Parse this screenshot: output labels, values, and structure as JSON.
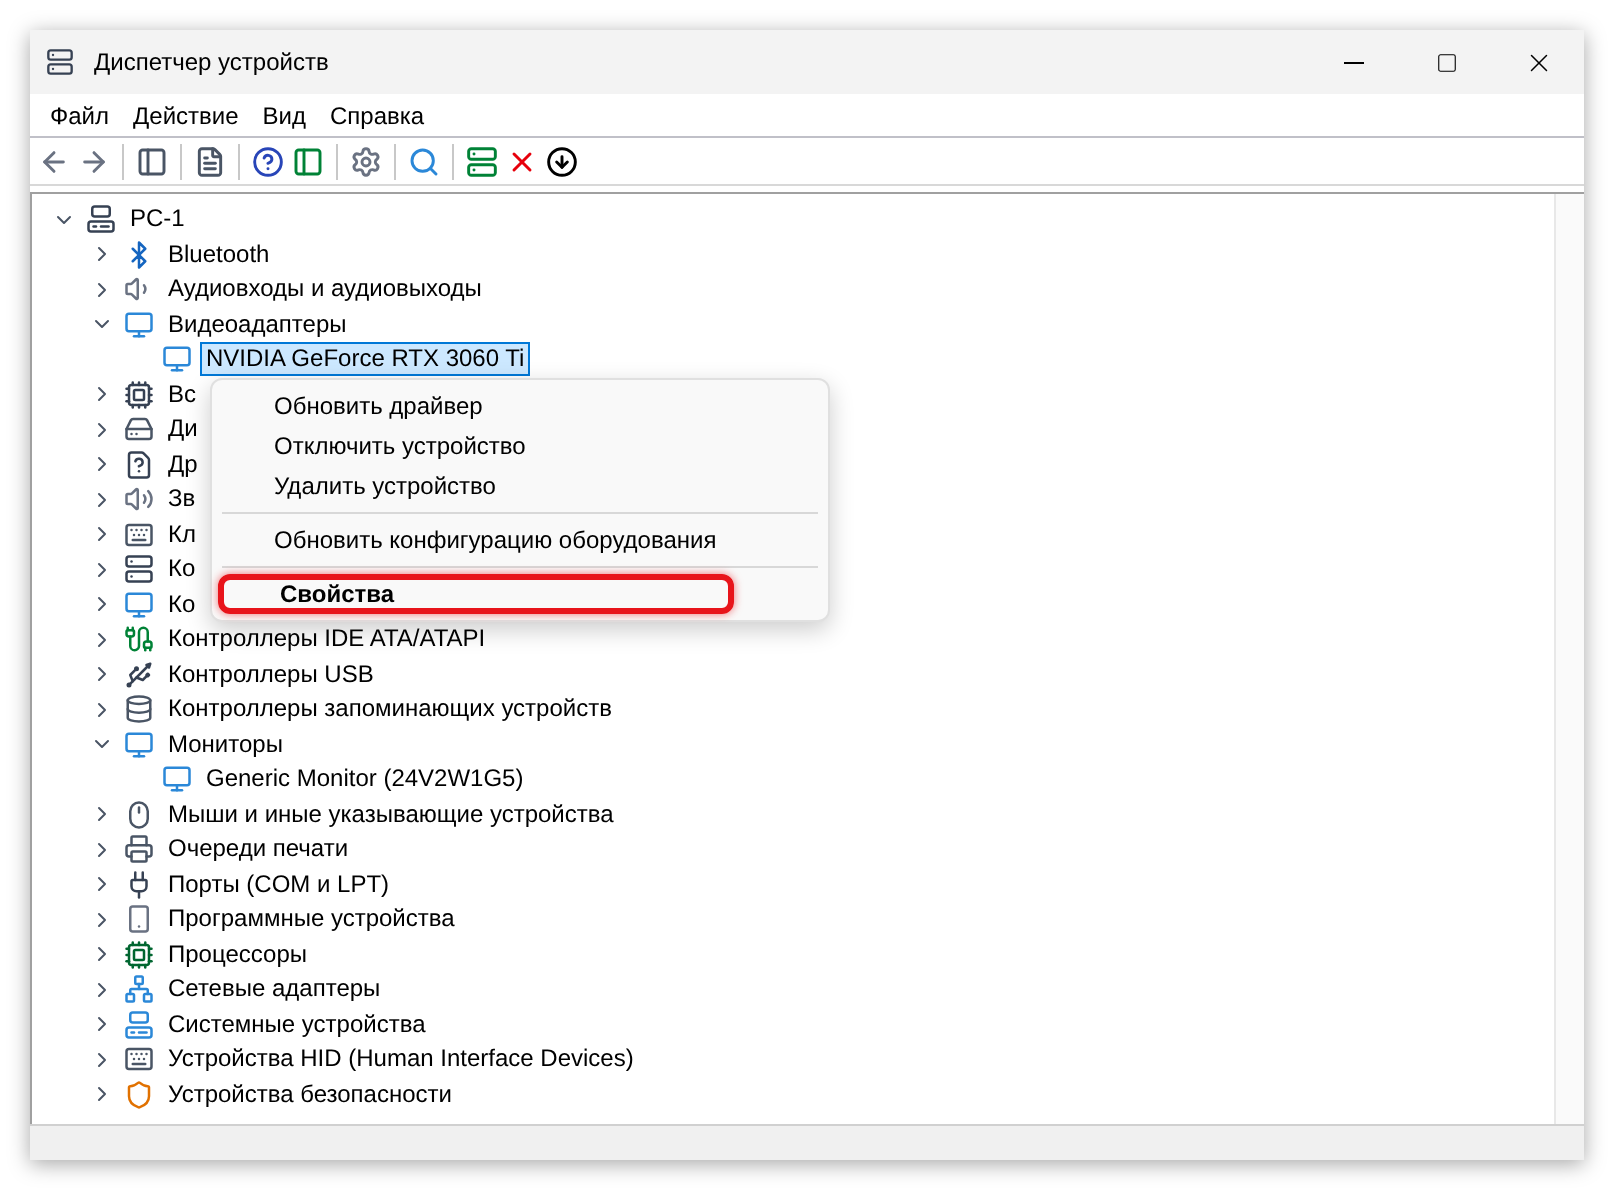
{
  "window": {
    "title": "Диспетчер устройств"
  },
  "menu_bar": [
    "Файл",
    "Действие",
    "Вид",
    "Справка"
  ],
  "tree": {
    "label": "PC-1",
    "expanded": true,
    "selected": false,
    "children": [
      {
        "label": "Bluetooth",
        "expanded": false,
        "selected": false
      },
      {
        "label": "Аудиовходы и аудиовыходы",
        "expanded": false,
        "selected": false
      },
      {
        "label": "Видеоадаптеры",
        "expanded": true,
        "selected": false,
        "children": [
          {
            "label": "NVIDIA GeForce RTX 3060 Ti",
            "selected": true
          }
        ]
      },
      {
        "label": "Вс",
        "expanded": false,
        "selected": false
      },
      {
        "label": "Ди",
        "expanded": false,
        "selected": false
      },
      {
        "label": "Др",
        "expanded": false,
        "selected": false
      },
      {
        "label": "Зв",
        "expanded": false,
        "selected": false
      },
      {
        "label": "Кл",
        "expanded": false,
        "selected": false
      },
      {
        "label": "Ко",
        "expanded": false,
        "selected": false
      },
      {
        "label": "Ко",
        "expanded": false,
        "selected": false
      },
      {
        "label": "Контроллеры IDE ATA/ATAPI",
        "expanded": false,
        "selected": false
      },
      {
        "label": "Контроллеры USB",
        "expanded": false,
        "selected": false
      },
      {
        "label": "Контроллеры запоминающих устройств",
        "expanded": false,
        "selected": false
      },
      {
        "label": "Мониторы",
        "expanded": true,
        "selected": false,
        "children": [
          {
            "label": "Generic Monitor (24V2W1G5)",
            "selected": false
          }
        ]
      },
      {
        "label": "Мыши и иные указывающие устройства",
        "expanded": false,
        "selected": false
      },
      {
        "label": "Очереди печати",
        "expanded": false,
        "selected": false
      },
      {
        "label": "Порты (COM и LPT)",
        "expanded": false,
        "selected": false
      },
      {
        "label": "Программные устройства",
        "expanded": false,
        "selected": false
      },
      {
        "label": "Процессоры",
        "expanded": false,
        "selected": false
      },
      {
        "label": "Сетевые адаптеры",
        "expanded": false,
        "selected": false
      },
      {
        "label": "Системные устройства",
        "expanded": false,
        "selected": false
      },
      {
        "label": "Устройства HID (Human Interface Devices)",
        "expanded": false,
        "selected": false
      },
      {
        "label": "Устройства безопасности",
        "expanded": false,
        "selected": false
      }
    ]
  },
  "context_menu": [
    {
      "kind": "item",
      "label": "Обновить драйвер",
      "default": false,
      "highlighted": false
    },
    {
      "kind": "item",
      "label": "Отключить устройство",
      "default": false,
      "highlighted": false
    },
    {
      "kind": "item",
      "label": "Удалить устройство",
      "default": false,
      "highlighted": false
    },
    {
      "kind": "separator"
    },
    {
      "kind": "item",
      "label": "Обновить конфигурацию оборудования",
      "default": false,
      "highlighted": false
    },
    {
      "kind": "separator"
    },
    {
      "kind": "item",
      "label": "Свойства",
      "default": true,
      "highlighted": true
    }
  ]
}
